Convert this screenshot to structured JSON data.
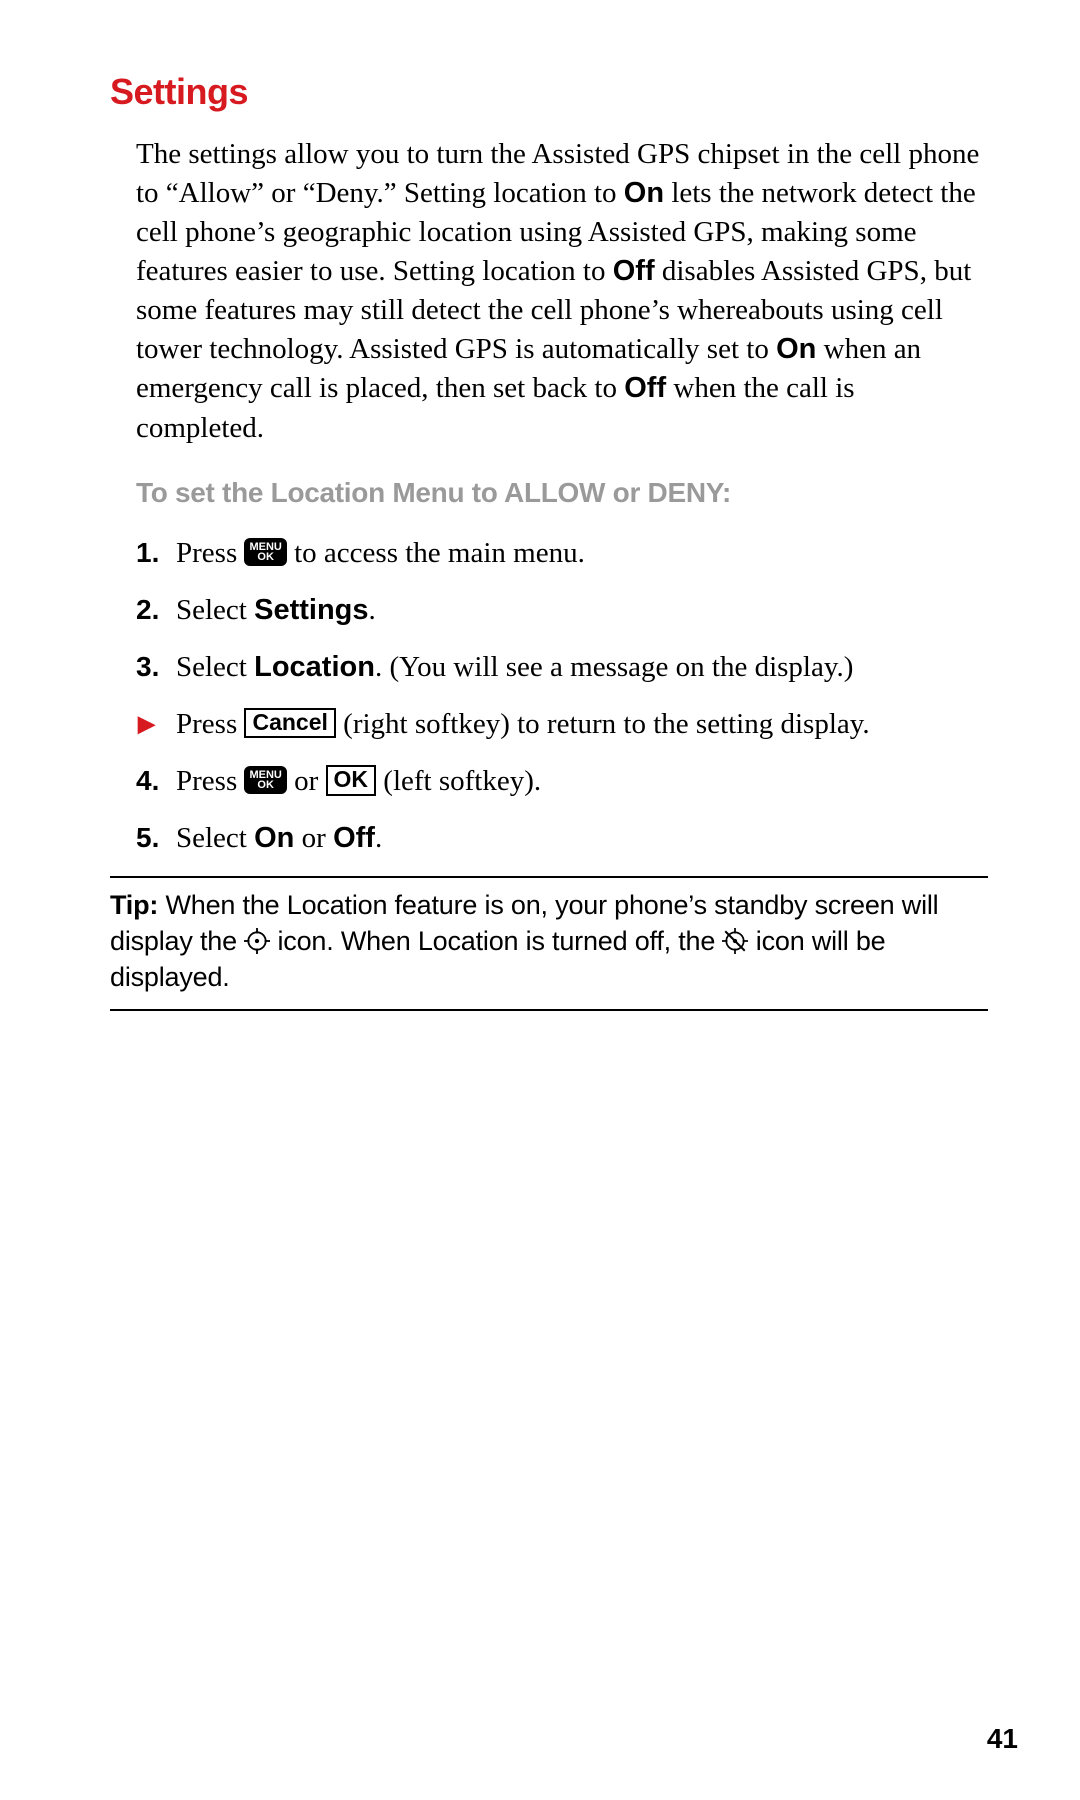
{
  "heading": "Settings",
  "intro": {
    "p1a": "The settings allow you to turn the Assisted GPS chipset in the cell phone to “Allow” or “Deny.” Setting location to ",
    "on": "On",
    "p1b": " lets the network detect the cell phone’s geographic location using Assisted GPS, making some features easier to use. Setting location to ",
    "off": "Off",
    "p1c": " disables Assisted GPS, but some features may still detect the cell phone’s whereabouts using cell tower technology. Assisted GPS is automatically set to ",
    "p1d": " when an emergency call is placed, then set back to ",
    "p1e": " when the call is completed."
  },
  "subhead": "To set the Location Menu to ALLOW or DENY:",
  "key_menu_top": "MENU",
  "key_menu_bot": "OK",
  "softkey_cancel": "Cancel",
  "softkey_ok": "OK",
  "steps": {
    "s1": {
      "num": "1.",
      "a": "Press ",
      "b": " to access the main menu."
    },
    "s2": {
      "num": "2.",
      "a": "Select ",
      "bold": "Settings",
      "b": "."
    },
    "s3": {
      "num": "3.",
      "a": "Select ",
      "bold": "Location",
      "b": ". (You will see a message on the display.)"
    },
    "sarrow": {
      "num": "▶",
      "a": "Press ",
      "b": " (right softkey) to return to the setting display."
    },
    "s4": {
      "num": "4.",
      "a": "Press ",
      "mid": " or ",
      "b": " (left softkey)."
    },
    "s5": {
      "num": "5.",
      "a": "Select ",
      "on": "On",
      "mid": " or ",
      "off": "Off",
      "b": "."
    }
  },
  "tip": {
    "label": "Tip:",
    "a": " When the Location feature is on, your phone’s standby screen will display the ",
    "b": " icon. When Location is turned off, the ",
    "c": " icon will be displayed."
  },
  "page_number": "41"
}
